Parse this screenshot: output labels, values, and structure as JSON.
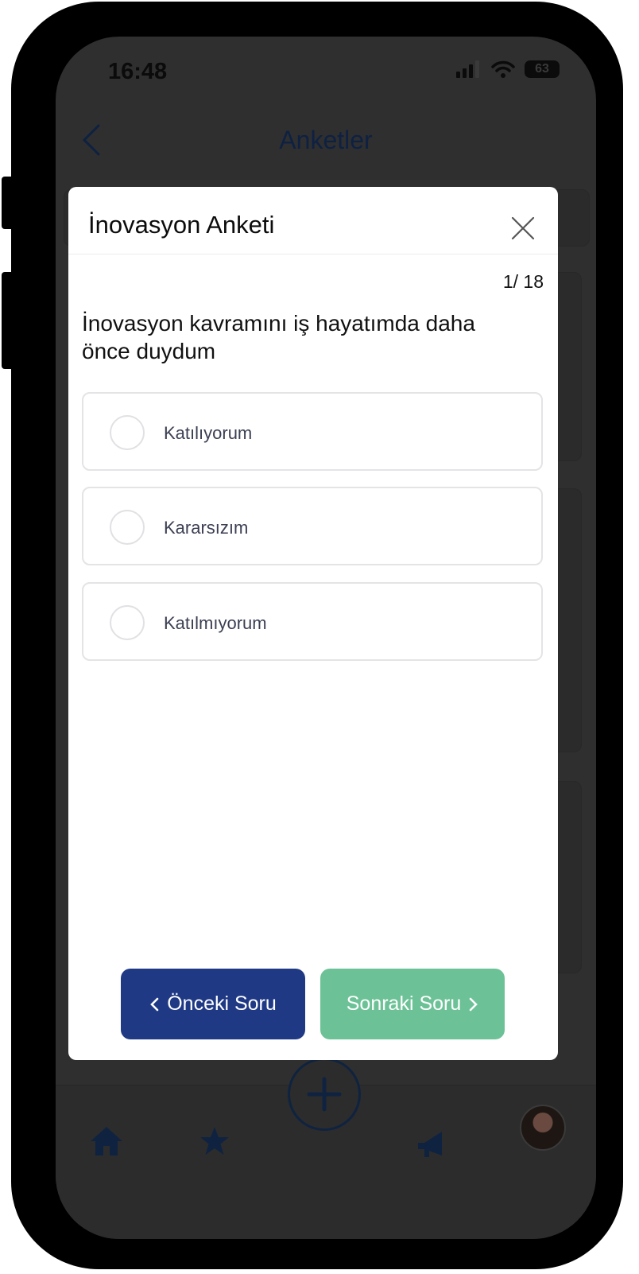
{
  "status_bar": {
    "time": "16:48",
    "battery": "63"
  },
  "background_app": {
    "title": "Anketler"
  },
  "modal": {
    "title": "İnovasyon Anketi",
    "counter": "1/ 18",
    "question": "İnovasyon kavramını iş hayatımda daha önce duydum",
    "options": [
      {
        "label": "Katılıyorum"
      },
      {
        "label": "Kararsızım"
      },
      {
        "label": "Katılmıyorum"
      }
    ],
    "prev_button": "Önceki Soru",
    "next_button": "Sonraki Soru"
  },
  "colors": {
    "primary": "#1f3984",
    "success": "#6cc296",
    "overlay": "#2f2f2f"
  },
  "icons": {
    "close": "close-icon",
    "back": "chevron-left-icon",
    "prev": "chevron-left-icon",
    "next": "chevron-right-icon",
    "home": "home-icon",
    "star": "star-icon",
    "add": "plus-icon",
    "megaphone": "megaphone-icon"
  }
}
